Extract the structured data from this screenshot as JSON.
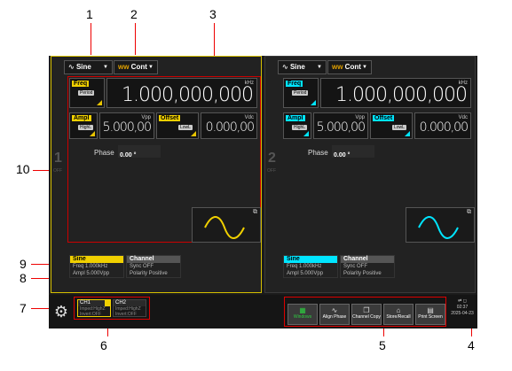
{
  "callouts": [
    "1",
    "2",
    "3",
    "4",
    "5",
    "6",
    "7",
    "8",
    "9",
    "10"
  ],
  "colors": {
    "ch1_accent": "#f0d000",
    "ch2_accent": "#00e5ff",
    "callout_line": "#e00000",
    "screen_bg": "#1b1b1b"
  },
  "channel1": {
    "wave_button": "Sine",
    "mode_button": "Cont",
    "freq_tag": "Freq",
    "freq_sub": "Period",
    "freq_value": "1.000,000,000",
    "freq_unit": "kHz",
    "ampl_tag": "Ampl",
    "ampl_sub": "HighL",
    "ampl_value": "5.000,00",
    "ampl_unit": "Vpp",
    "offset_tag": "Offset",
    "offset_sub": "LowL",
    "offset_value": "0.000,00",
    "offset_unit": "Vdc",
    "phase_label": "Phase",
    "phase_value": "0.00 °",
    "side_number": "1",
    "side_state": "OFF",
    "wave_icon": "sine-wave-icon",
    "info_wave": {
      "title": "Sine",
      "line1": "Freq 1.000kHz",
      "line2": "Ampl 5.000Vpp"
    },
    "info_channel": {
      "title": "Channel",
      "line1": "Sync OFF",
      "line2": "Polarity Positive"
    }
  },
  "channel2": {
    "wave_button": "Sine",
    "mode_button": "Cont",
    "freq_tag": "Freq",
    "freq_sub": "Period",
    "freq_value": "1.000,000,000",
    "freq_unit": "kHz",
    "ampl_tag": "Ampl",
    "ampl_sub": "HighL",
    "ampl_value": "5.000,00",
    "ampl_unit": "Vpp",
    "offset_tag": "Offset",
    "offset_sub": "LowL",
    "offset_value": "0.000,00",
    "offset_unit": "Vdc",
    "phase_label": "Phase",
    "phase_value": "0.00 °",
    "side_number": "2",
    "side_state": "OFF",
    "wave_icon": "sine-wave-icon",
    "info_wave": {
      "title": "Sine",
      "line1": "Freq 1.000kHz",
      "line2": "Ampl 5.000Vpp"
    },
    "info_channel": {
      "title": "Channel",
      "line1": "Sync OFF",
      "line2": "Polarity Positive"
    }
  },
  "status": {
    "ch1_label": "CH1",
    "ch1_line1": "Imped:HighZ",
    "ch1_line2": "Invert:OFF",
    "ch2_label": "CH2",
    "ch2_line1": "Imped:HighZ",
    "ch2_line2": "Invert:OFF"
  },
  "shortcuts": [
    {
      "label": "Windows",
      "icon": "windows-icon"
    },
    {
      "label": "Align Phase",
      "icon": "align-phase-icon"
    },
    {
      "label": "Channel Copy",
      "icon": "copy-icon"
    },
    {
      "label": "Store/Recall",
      "icon": "store-icon"
    },
    {
      "label": "Print Screen",
      "icon": "print-icon"
    }
  ],
  "clock": {
    "time": "02:37",
    "date": "2025-04-23",
    "usb": "⇄ ◻"
  },
  "settings_icon": "gear-icon"
}
